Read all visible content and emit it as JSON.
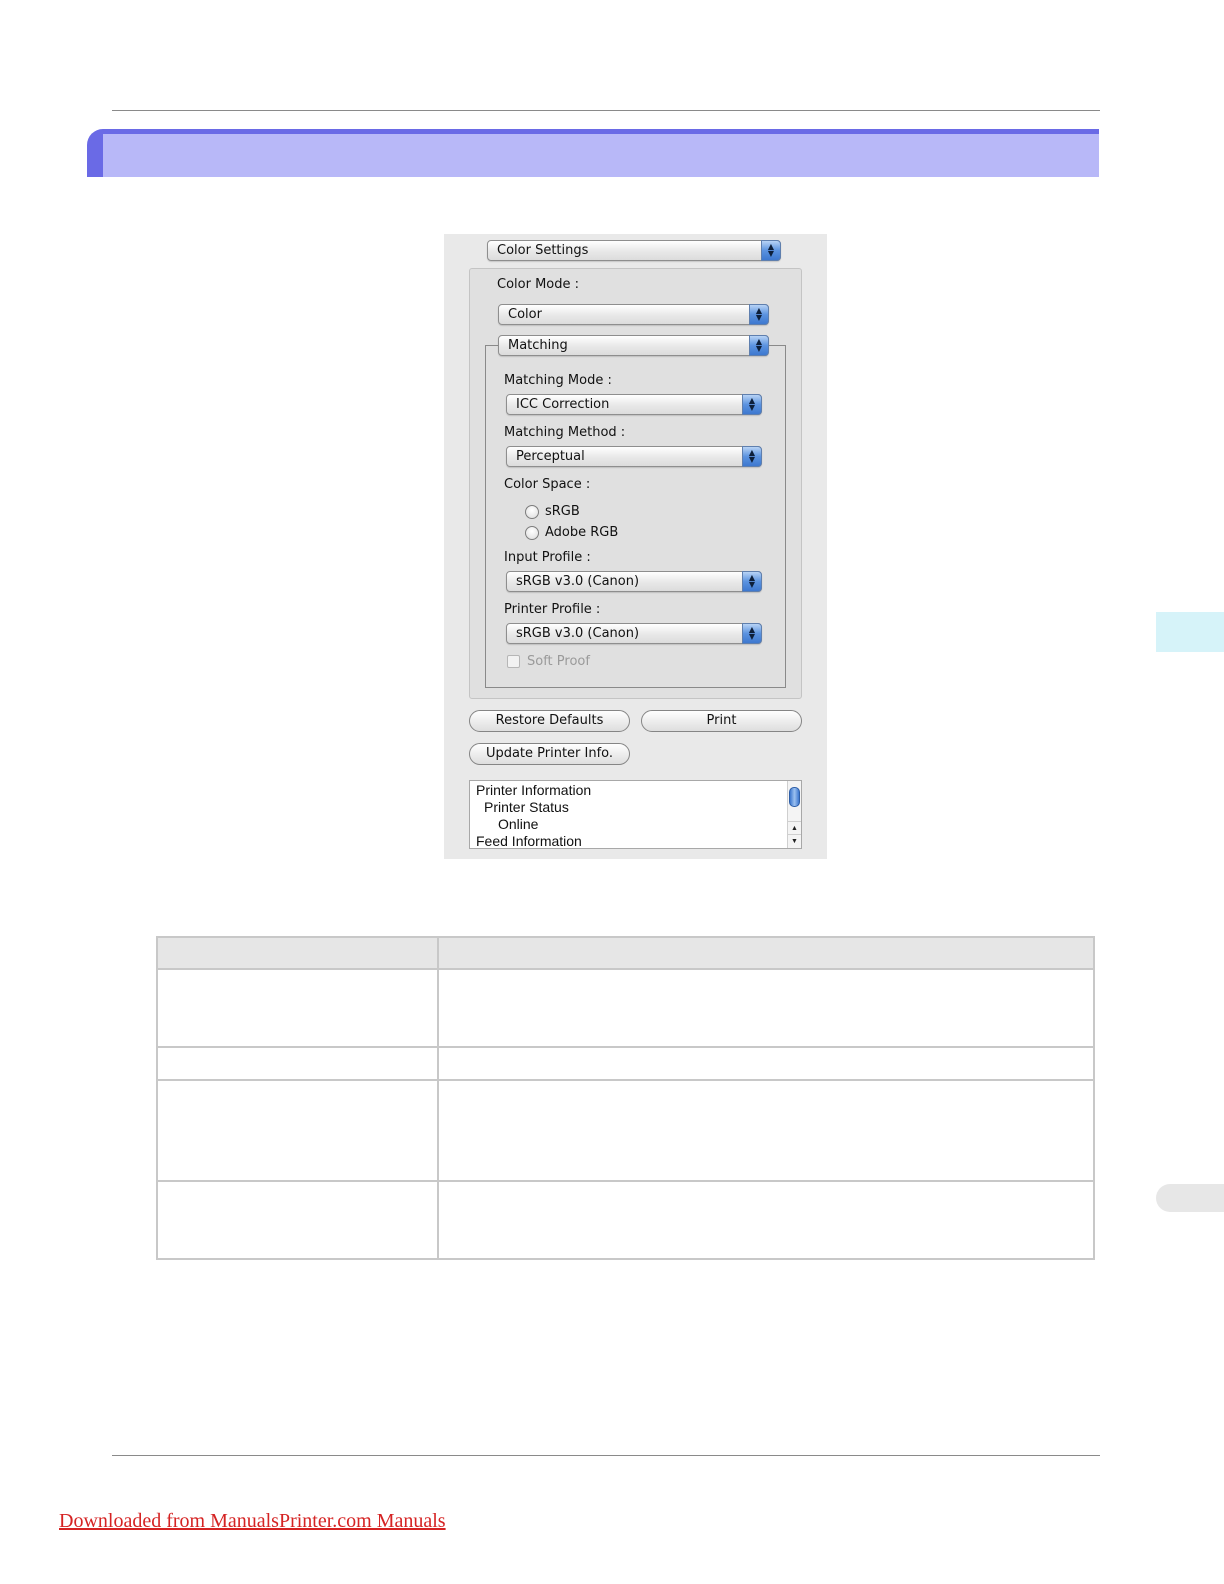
{
  "dialog": {
    "panel_popup": "Color Settings",
    "color_mode_label": "Color Mode :",
    "color_mode_value": "Color",
    "section_popup": "Matching",
    "matching_mode_label": "Matching Mode :",
    "matching_mode_value": "ICC Correction",
    "matching_method_label": "Matching Method :",
    "matching_method_value": "Perceptual",
    "color_space_label": "Color Space :",
    "color_space_options": [
      "sRGB",
      "Adobe RGB"
    ],
    "input_profile_label": "Input Profile :",
    "input_profile_value": "sRGB v3.0 (Canon)",
    "printer_profile_label": "Printer Profile :",
    "printer_profile_value": "sRGB v3.0 (Canon)",
    "soft_proof_label": "Soft Proof",
    "restore_defaults_label": "Restore Defaults",
    "print_label": "Print",
    "update_printer_label": "Update Printer Info.",
    "info_list": [
      "Printer Information",
      "Printer Status",
      "Online",
      "Feed Information"
    ]
  },
  "footer": {
    "link_text": "Downloaded from ManualsPrinter.com Manuals"
  }
}
